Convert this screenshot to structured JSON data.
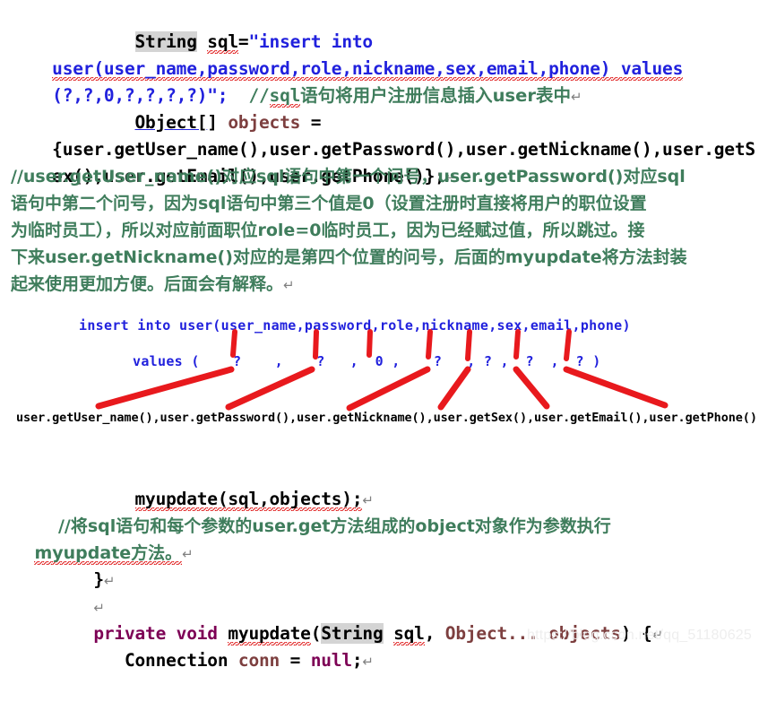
{
  "document": {
    "watermark": "https://blog.csdn.net/qq_51180625",
    "pilcrow": "↵"
  },
  "code": {
    "line1": {
      "indent": "        ",
      "kw_string": "String",
      "var_sql": "sql",
      "equals": "=",
      "string_start": "\"insert into"
    },
    "line2": {
      "string": "user(user_name,password,role,nickname,sex,email,phone) values"
    },
    "line3": {
      "string": "(?,?,0,?,?,?,?)\";",
      "comment": "//sql语句将用户注册信息插入user表中",
      "comment_prefix": "//",
      "comment_sql": "sql",
      "comment_rest": "语句将用户注册信息插入user表中"
    },
    "line4": {
      "type_link": "Object[",
      "type_rest": "] ",
      "var": "objects",
      "equals": " ="
    },
    "line5": {
      "open": "{",
      "parts": "user.getUser_name(),user.getPassword(),user.getNickname(),user.getS"
    },
    "line6": {
      "parts": "ex(),user.getEmail(),user.getPhone()};"
    },
    "line_myupdate": {
      "call": "myupdate(sql,objects);"
    },
    "comment_myupdate_1": "//将sql语句和每个参数的user.get方法组成的object对象作为参数执行",
    "comment_myupdate_2": "myupdate方法。",
    "close_brace": "}",
    "method_sig": {
      "private": "private",
      "void": "void",
      "name": "myupdate",
      "paren_open": "(",
      "param_type": "String",
      "param_name": "sql",
      "comma": ", ",
      "param2": "Object... objects",
      "paren_close": ") {"
    },
    "conn_line": {
      "type": "Connection",
      "name": "conn",
      "equals": " = ",
      "value": "null",
      "semi": ";"
    }
  },
  "comment_block": {
    "line1": "//user.getUser_name()对应sql语句中第一个问号，user.getPassword()对应sql",
    "line2": "语句中第二个问号，因为sql语句中第三个值是0（设置注册时直接将用户的职位设置",
    "line3": "为临时员工），所以对应前面职位role=0临时员工，因为已经赋过值，所以跳过。接",
    "line4": "下来user.getNickname()对应的是第四个位置的问号，后面的myupdate将方法封装",
    "line5": "起来使用更加方便。后面会有解释。"
  },
  "diagram": {
    "type": "annotated-sql-mapping",
    "accent_color": "#e8191d",
    "sql_color": "#2121dd",
    "line_sql_columns": "insert into user(user_name,password,role,nickname,sex,email,phone)",
    "line_values": "values (    ?    ,    ?   ,  0 ,    ?   , ? ,  ?  ,  ? )",
    "line_getters": "user.getUser_name(),user.getPassword(),user.getNickname(),user.getSex(),user.getEmail(),user.getPhone()",
    "columns": [
      "user_name",
      "password",
      "role",
      "nickname",
      "sex",
      "email",
      "phone"
    ],
    "placeholders": [
      "?",
      "?",
      "0",
      "?",
      "?",
      "?",
      "?"
    ],
    "getters": [
      "user.getUser_name()",
      "user.getPassword()",
      "user.getNickname()",
      "user.getSex()",
      "user.getEmail()",
      "user.getPhone()"
    ],
    "mappings": [
      {
        "column": "user_name",
        "placeholder": "?",
        "getter": "user.getUser_name()"
      },
      {
        "column": "password",
        "placeholder": "?",
        "getter": "user.getPassword()"
      },
      {
        "column": "role",
        "placeholder": "0",
        "getter": null
      },
      {
        "column": "nickname",
        "placeholder": "?",
        "getter": "user.getNickname()"
      },
      {
        "column": "sex",
        "placeholder": "?",
        "getter": "user.getSex()"
      },
      {
        "column": "email",
        "placeholder": "?",
        "getter": "user.getEmail()"
      },
      {
        "column": "phone",
        "placeholder": "?",
        "getter": "user.getPhone()"
      }
    ]
  }
}
